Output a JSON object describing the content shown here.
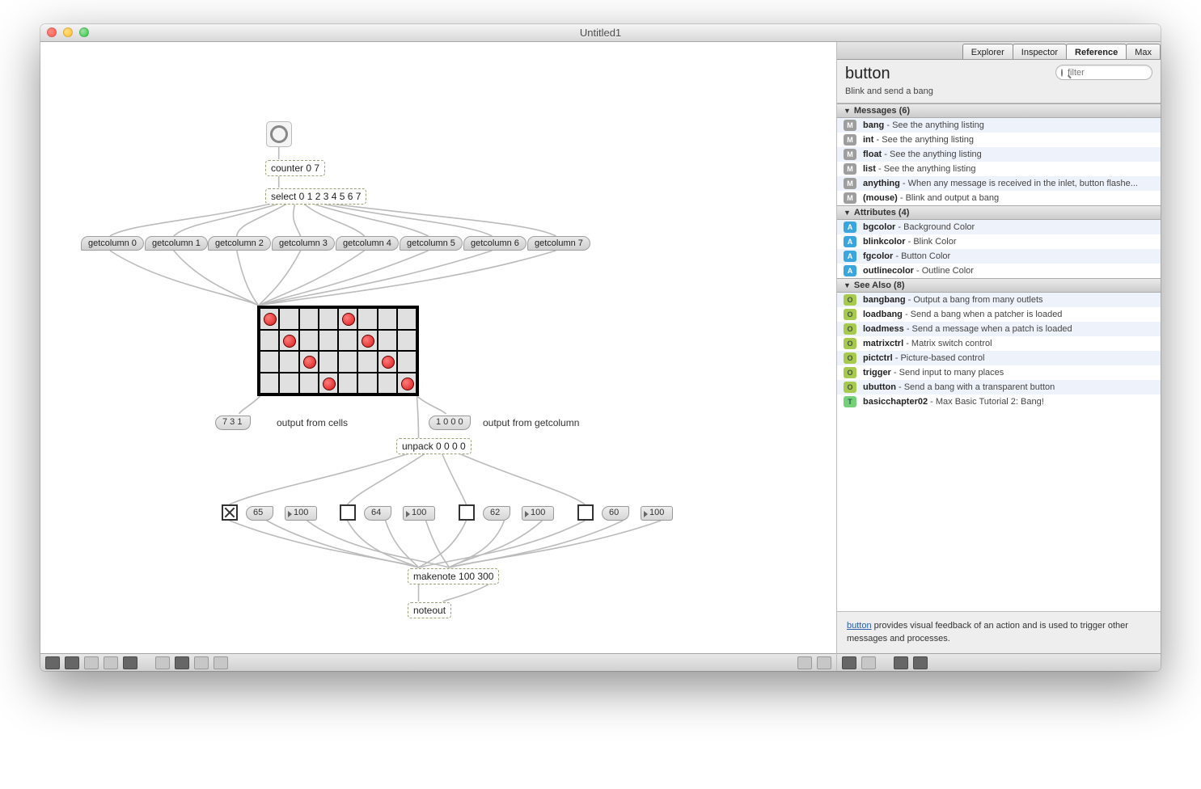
{
  "window": {
    "title": "Untitled1"
  },
  "patch": {
    "counter": "counter 0 7",
    "select": "select 0 1 2 3 4 5 6 7",
    "getcols": [
      "getcolumn 0",
      "getcolumn 1",
      "getcolumn 2",
      "getcolumn 3",
      "getcolumn 4",
      "getcolumn 5",
      "getcolumn 6",
      "getcolumn 7"
    ],
    "cells_out_value": "7 3 1",
    "cells_out_label": "output from cells",
    "col_out_value": "1 0 0 0",
    "col_out_label": "output from getcolumn",
    "unpack": "unpack 0 0 0 0",
    "row_notes": [
      "65",
      "64",
      "62",
      "60"
    ],
    "row_vel": [
      "100",
      "100",
      "100",
      "100"
    ],
    "makenote": "makenote 100 300",
    "noteout": "noteout",
    "matrix_on": [
      [
        0,
        0
      ],
      [
        1,
        1
      ],
      [
        2,
        2
      ],
      [
        3,
        3
      ],
      [
        4,
        0
      ],
      [
        5,
        1
      ],
      [
        6,
        2
      ],
      [
        7,
        3
      ]
    ]
  },
  "sidebar": {
    "tabs": [
      "Explorer",
      "Inspector",
      "Reference",
      "Max"
    ],
    "active_tab": 2,
    "object": "button",
    "subtitle": "Blink and send a bang",
    "search_placeholder": "filter",
    "sections": {
      "messages": {
        "title": "Messages (6)",
        "items": [
          {
            "badge": "M",
            "name": "bang",
            "desc": "See the anything listing"
          },
          {
            "badge": "M",
            "name": "int",
            "desc": "See the anything listing"
          },
          {
            "badge": "M",
            "name": "float",
            "desc": "See the anything listing"
          },
          {
            "badge": "M",
            "name": "list",
            "desc": "See the anything listing"
          },
          {
            "badge": "M",
            "name": "anything",
            "desc": "When any message is received in the inlet, button flashe..."
          },
          {
            "badge": "M",
            "name": "(mouse)",
            "desc": "Blink and output a bang"
          }
        ]
      },
      "attributes": {
        "title": "Attributes (4)",
        "items": [
          {
            "badge": "A",
            "name": "bgcolor",
            "desc": "Background Color"
          },
          {
            "badge": "A",
            "name": "blinkcolor",
            "desc": "Blink Color"
          },
          {
            "badge": "A",
            "name": "fgcolor",
            "desc": "Button Color"
          },
          {
            "badge": "A",
            "name": "outlinecolor",
            "desc": "Outline Color"
          }
        ]
      },
      "seealso": {
        "title": "See Also (8)",
        "items": [
          {
            "badge": "O",
            "name": "bangbang",
            "desc": "Output a bang from many outlets"
          },
          {
            "badge": "O",
            "name": "loadbang",
            "desc": "Send a bang when a patcher is loaded"
          },
          {
            "badge": "O",
            "name": "loadmess",
            "desc": "Send a message when a patch is loaded"
          },
          {
            "badge": "O",
            "name": "matrixctrl",
            "desc": "Matrix switch control"
          },
          {
            "badge": "O",
            "name": "pictctrl",
            "desc": "Picture-based control"
          },
          {
            "badge": "O",
            "name": "trigger",
            "desc": "Send input to many places"
          },
          {
            "badge": "O",
            "name": "ubutton",
            "desc": "Send a bang with a transparent button"
          },
          {
            "badge": "T",
            "name": "basicchapter02",
            "desc": "Max Basic Tutorial 2: Bang!"
          }
        ]
      }
    },
    "description_link": "button",
    "description_rest": " provides visual feedback of an action and is used to trigger other messages and processes."
  }
}
